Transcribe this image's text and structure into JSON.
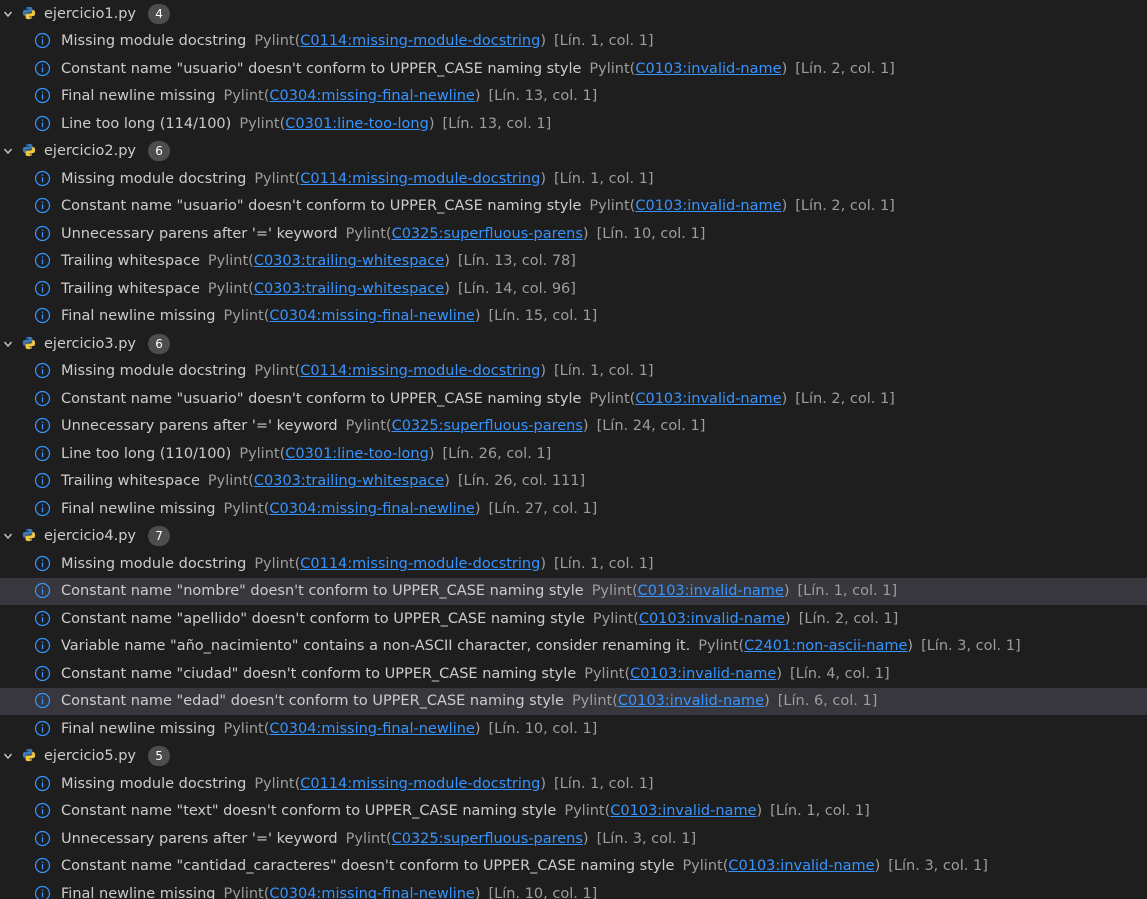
{
  "theme": {
    "info_color": "#3794ff",
    "selected_bg": "#37373d",
    "badge_bg": "#4d4d4d"
  },
  "files": [
    {
      "name": "ejercicio1.py",
      "count": "4",
      "issues": [
        {
          "message": "Missing module docstring",
          "source": "Pylint",
          "code": "C0114:missing-module-docstring",
          "location": "[Lín. 1, col. 1]"
        },
        {
          "message": "Constant name \"usuario\" doesn't conform to UPPER_CASE naming style",
          "source": "Pylint",
          "code": "C0103:invalid-name",
          "location": "[Lín. 2, col. 1]"
        },
        {
          "message": "Final newline missing",
          "source": "Pylint",
          "code": "C0304:missing-final-newline",
          "location": "[Lín. 13, col. 1]"
        },
        {
          "message": "Line too long (114/100)",
          "source": "Pylint",
          "code": "C0301:line-too-long",
          "location": "[Lín. 13, col. 1]"
        }
      ]
    },
    {
      "name": "ejercicio2.py",
      "count": "6",
      "issues": [
        {
          "message": "Missing module docstring",
          "source": "Pylint",
          "code": "C0114:missing-module-docstring",
          "location": "[Lín. 1, col. 1]"
        },
        {
          "message": "Constant name \"usuario\" doesn't conform to UPPER_CASE naming style",
          "source": "Pylint",
          "code": "C0103:invalid-name",
          "location": "[Lín. 2, col. 1]"
        },
        {
          "message": "Unnecessary parens after '=' keyword",
          "source": "Pylint",
          "code": "C0325:superfluous-parens",
          "location": "[Lín. 10, col. 1]"
        },
        {
          "message": "Trailing whitespace",
          "source": "Pylint",
          "code": "C0303:trailing-whitespace",
          "location": "[Lín. 13, col. 78]"
        },
        {
          "message": "Trailing whitespace",
          "source": "Pylint",
          "code": "C0303:trailing-whitespace",
          "location": "[Lín. 14, col. 96]"
        },
        {
          "message": "Final newline missing",
          "source": "Pylint",
          "code": "C0304:missing-final-newline",
          "location": "[Lín. 15, col. 1]"
        }
      ]
    },
    {
      "name": "ejercicio3.py",
      "count": "6",
      "issues": [
        {
          "message": "Missing module docstring",
          "source": "Pylint",
          "code": "C0114:missing-module-docstring",
          "location": "[Lín. 1, col. 1]"
        },
        {
          "message": "Constant name \"usuario\" doesn't conform to UPPER_CASE naming style",
          "source": "Pylint",
          "code": "C0103:invalid-name",
          "location": "[Lín. 2, col. 1]"
        },
        {
          "message": "Unnecessary parens after '=' keyword",
          "source": "Pylint",
          "code": "C0325:superfluous-parens",
          "location": "[Lín. 24, col. 1]"
        },
        {
          "message": "Line too long (110/100)",
          "source": "Pylint",
          "code": "C0301:line-too-long",
          "location": "[Lín. 26, col. 1]"
        },
        {
          "message": "Trailing whitespace",
          "source": "Pylint",
          "code": "C0303:trailing-whitespace",
          "location": "[Lín. 26, col. 111]"
        },
        {
          "message": "Final newline missing",
          "source": "Pylint",
          "code": "C0304:missing-final-newline",
          "location": "[Lín. 27, col. 1]"
        }
      ]
    },
    {
      "name": "ejercicio4.py",
      "count": "7",
      "issues": [
        {
          "message": "Missing module docstring",
          "source": "Pylint",
          "code": "C0114:missing-module-docstring",
          "location": "[Lín. 1, col. 1]"
        },
        {
          "message": "Constant name \"nombre\" doesn't conform to UPPER_CASE naming style",
          "source": "Pylint",
          "code": "C0103:invalid-name",
          "location": "[Lín. 1, col. 1]",
          "selected": true
        },
        {
          "message": "Constant name \"apellido\" doesn't conform to UPPER_CASE naming style",
          "source": "Pylint",
          "code": "C0103:invalid-name",
          "location": "[Lín. 2, col. 1]"
        },
        {
          "message": "Variable name \"año_nacimiento\" contains a non-ASCII character, consider renaming it.",
          "source": "Pylint",
          "code": "C2401:non-ascii-name",
          "location": "[Lín. 3, col. 1]"
        },
        {
          "message": "Constant name \"ciudad\" doesn't conform to UPPER_CASE naming style",
          "source": "Pylint",
          "code": "C0103:invalid-name",
          "location": "[Lín. 4, col. 1]"
        },
        {
          "message": "Constant name \"edad\" doesn't conform to UPPER_CASE naming style",
          "source": "Pylint",
          "code": "C0103:invalid-name",
          "location": "[Lín. 6, col. 1]",
          "selected": true
        },
        {
          "message": "Final newline missing",
          "source": "Pylint",
          "code": "C0304:missing-final-newline",
          "location": "[Lín. 10, col. 1]"
        }
      ]
    },
    {
      "name": "ejercicio5.py",
      "count": "5",
      "issues": [
        {
          "message": "Missing module docstring",
          "source": "Pylint",
          "code": "C0114:missing-module-docstring",
          "location": "[Lín. 1, col. 1]"
        },
        {
          "message": "Constant name \"text\" doesn't conform to UPPER_CASE naming style",
          "source": "Pylint",
          "code": "C0103:invalid-name",
          "location": "[Lín. 1, col. 1]"
        },
        {
          "message": "Unnecessary parens after '=' keyword",
          "source": "Pylint",
          "code": "C0325:superfluous-parens",
          "location": "[Lín. 3, col. 1]"
        },
        {
          "message": "Constant name \"cantidad_caracteres\" doesn't conform to UPPER_CASE naming style",
          "source": "Pylint",
          "code": "C0103:invalid-name",
          "location": "[Lín. 3, col. 1]"
        },
        {
          "message": "Final newline missing",
          "source": "Pylint",
          "code": "C0304:missing-final-newline",
          "location": "[Lín. 10, col. 1]"
        }
      ]
    }
  ]
}
